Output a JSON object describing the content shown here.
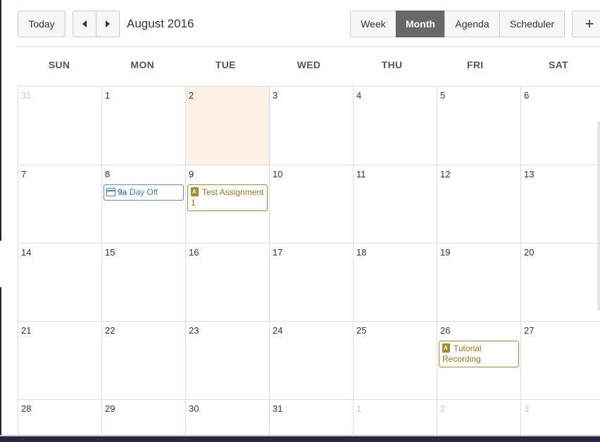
{
  "toolbar": {
    "today_label": "Today",
    "title": "August 2016",
    "views": [
      {
        "label": "Week",
        "active": false
      },
      {
        "label": "Month",
        "active": true
      },
      {
        "label": "Agenda",
        "active": false
      },
      {
        "label": "Scheduler",
        "active": false
      }
    ],
    "add_label": "+"
  },
  "days_of_week": [
    "SUN",
    "MON",
    "TUE",
    "WED",
    "THU",
    "FRI",
    "SAT"
  ],
  "weeks": [
    [
      "31",
      "1",
      "2",
      "3",
      "4",
      "5",
      "6"
    ],
    [
      "7",
      "8",
      "9",
      "10",
      "11",
      "12",
      "13"
    ],
    [
      "14",
      "15",
      "16",
      "17",
      "18",
      "19",
      "20"
    ],
    [
      "21",
      "22",
      "23",
      "24",
      "25",
      "26",
      "27"
    ],
    [
      "28",
      "29",
      "30",
      "31",
      "1",
      "2",
      "3"
    ]
  ],
  "events": {
    "day_off": {
      "time": "9a",
      "title": "Day Off",
      "icon": "calendar-icon"
    },
    "test_assignment": {
      "title": "Test Assignment 1",
      "icon": "assignment-icon"
    },
    "tutorial": {
      "title": "Tutorial Recording",
      "icon": "assignment-icon"
    }
  },
  "colors": {
    "today_highlight": "#fdf1e6",
    "active_view": "#686868",
    "event_blue": "#4a7fc2",
    "event_gold": "#9a7a14"
  }
}
